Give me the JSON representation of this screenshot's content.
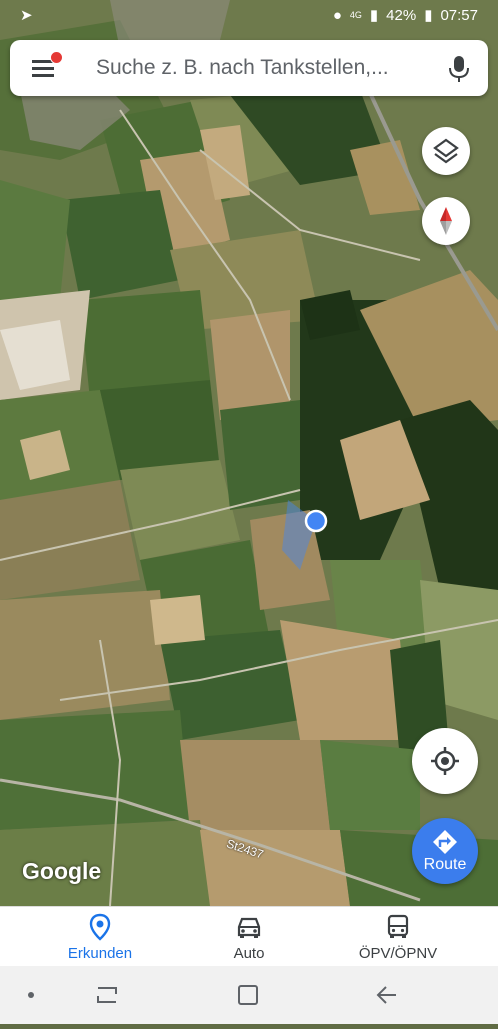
{
  "statusbar": {
    "time": "07:57",
    "battery": "42%",
    "network": "4G",
    "nav_icon": "navigation-arrow-icon"
  },
  "search": {
    "placeholder": "Suche z. B. nach Tankstellen,...",
    "has_notification": true
  },
  "map": {
    "road_label": "St2437",
    "attribution": "Google",
    "location_marker": "blue-dot"
  },
  "fab": {
    "route_label": "Route"
  },
  "bottom_nav": {
    "items": [
      {
        "label": "Erkunden",
        "icon": "pin-icon",
        "active": true
      },
      {
        "label": "Auto",
        "icon": "car-icon",
        "active": false
      },
      {
        "label": "ÖPV/ÖPNV",
        "icon": "bus-icon",
        "active": false
      }
    ]
  },
  "colors": {
    "accent": "#1a73e8",
    "route_fab": "#3b7ded",
    "marker": "#4285f4",
    "notification": "#e53935"
  }
}
